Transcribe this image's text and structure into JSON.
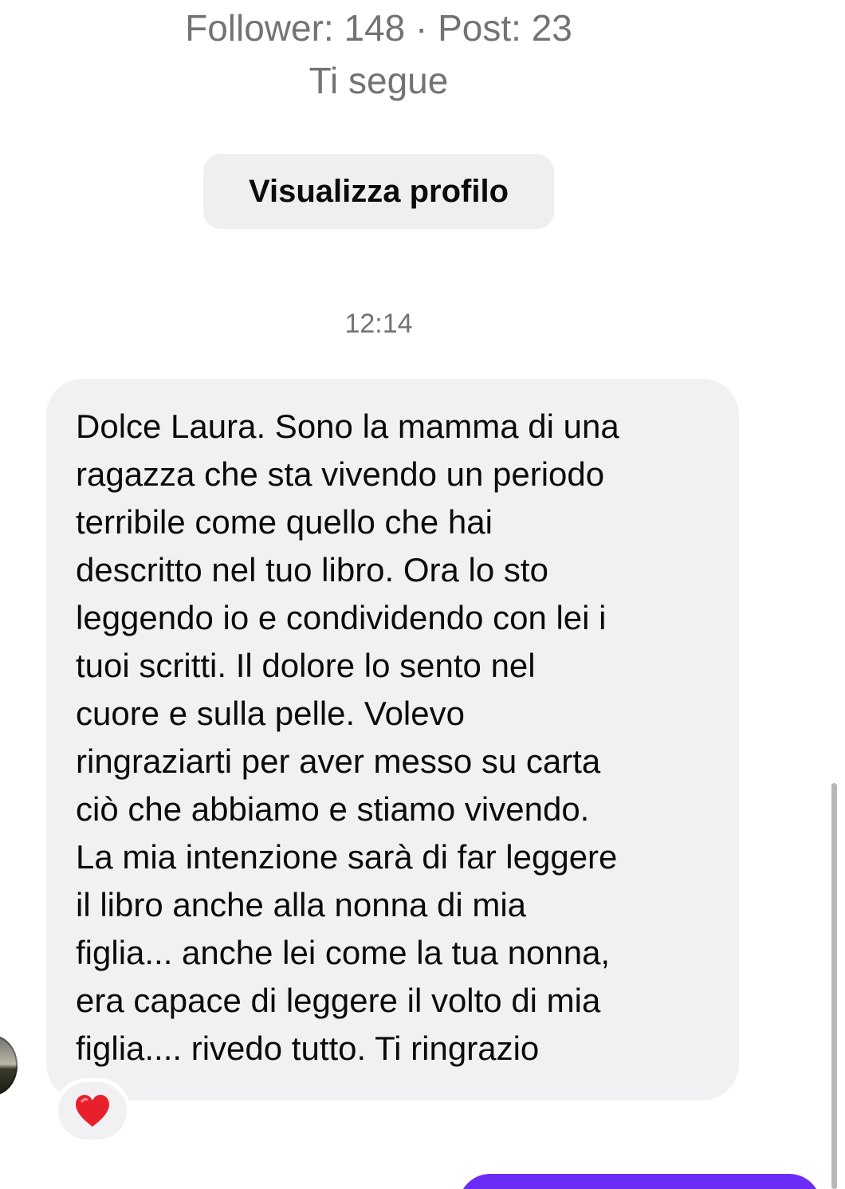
{
  "profile": {
    "stats": "Follower: 148 · Post: 23",
    "follow_status": "Ti segue",
    "view_profile_label": "Visualizza profilo"
  },
  "conversation": {
    "timestamp": "12:14",
    "incoming_message": {
      "lines": [
        "Dolce Laura. Sono la mamma di una",
        "ragazza che sta vivendo un periodo",
        "terribile come quello che hai",
        "descritto nel tuo libro. Ora lo sto",
        "leggendo io e condividendo con lei i",
        "tuoi scritti. Il dolore lo sento nel",
        "cuore e sulla pelle. Volevo",
        "ringraziarti per aver messo su carta",
        "ciò che abbiamo e stiamo vivendo.",
        "La mia intenzione sarà di far leggere",
        "il libro anche alla nonna di mia",
        "figlia... anche lei come la tua nonna,",
        "era capace di leggere il volto di mia",
        "figlia.... rivedo tutto. Ti ringrazio"
      ],
      "reaction": "heart-icon"
    }
  },
  "colors": {
    "secondary_text": "#737373",
    "bubble_background": "#f1f1f3",
    "button_background": "#efeff1",
    "outgoing_bubble": "#6b2cf5",
    "reaction_heart": "#e8202b"
  }
}
